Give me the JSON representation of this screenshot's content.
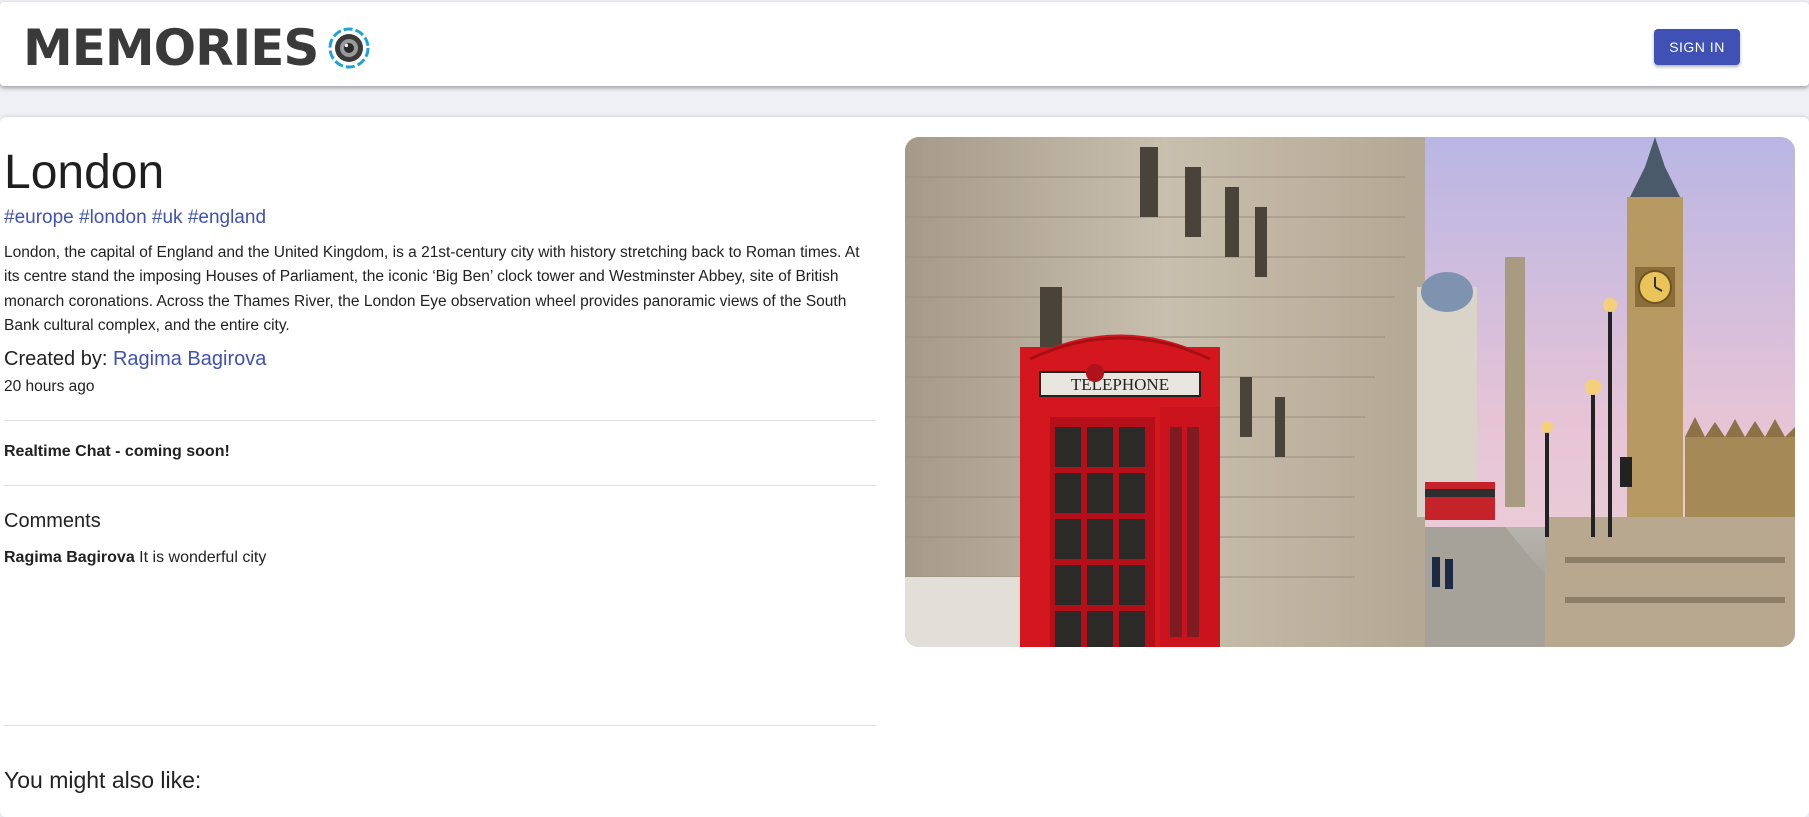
{
  "header": {
    "brand_text": "MEMORIES",
    "signin_label": "SIGN IN"
  },
  "post": {
    "title": "London",
    "tags": "#europe #london #uk #england",
    "description": "London, the capital of England and the United Kingdom, is a 21st-century city with history stretching back to Roman times. At its centre stand the imposing Houses of Parliament, the iconic ‘Big Ben’ clock tower and Westminster Abbey, site of British monarch coronations. Across the Thames River, the London Eye observation wheel provides panoramic views of the South Bank cultural complex, and the entire city.",
    "created_by_label": "Created by:",
    "author": "Ragima Bagirova",
    "time_ago": "20 hours ago",
    "image_text": "TELEPHONE"
  },
  "chat": {
    "notice": "Realtime Chat - coming soon!"
  },
  "comments": {
    "heading": "Comments",
    "items": [
      {
        "author": "Ragima Bagirova",
        "text": "It is wonderful city"
      }
    ]
  },
  "recommended": {
    "heading": "You might also like:"
  },
  "colors": {
    "accent": "#3f51b5",
    "logo_ring": "#1fa3d6"
  }
}
